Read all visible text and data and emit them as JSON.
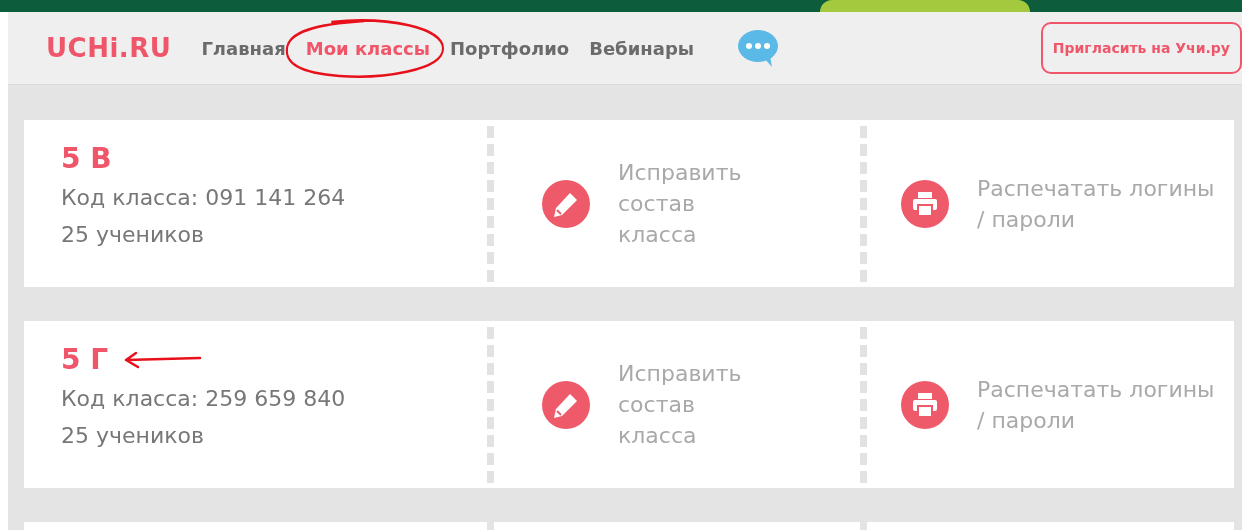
{
  "header": {
    "logo": "UCHi.RU",
    "nav": [
      {
        "label": "Главная",
        "selected": false,
        "circled": false
      },
      {
        "label": "Мои классы",
        "selected": true,
        "circled": true
      },
      {
        "label": "Портфолио",
        "selected": false,
        "circled": false
      },
      {
        "label": "Вебинары",
        "selected": false,
        "circled": false
      }
    ],
    "invite_button": "Пригласить на Учи.ру"
  },
  "classes": [
    {
      "name": "5 В",
      "code": "Код класса: 091 141 264",
      "students": "25 учеников",
      "arrow": false,
      "actions": [
        {
          "kind": "edit",
          "label": "Исправить состав класса"
        },
        {
          "kind": "print",
          "label": "Распечатать логины / пароли"
        }
      ]
    },
    {
      "name": "5 Г",
      "code": "Код класса: 259 659 840",
      "students": "25 учеников",
      "arrow": true,
      "actions": [
        {
          "kind": "edit",
          "label": "Исправить состав класса"
        },
        {
          "kind": "print",
          "label": "Распечатать логины / пароли"
        }
      ]
    }
  ]
}
